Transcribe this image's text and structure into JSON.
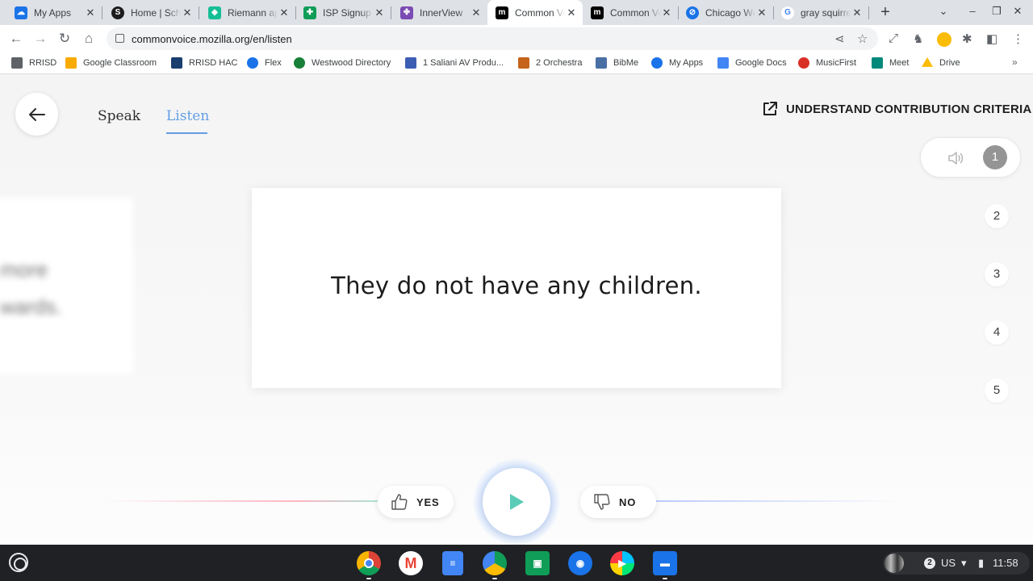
{
  "browser": {
    "tabs": [
      {
        "title": "My Apps",
        "icon": "cloud-icon",
        "color": "#1a73e8"
      },
      {
        "title": "Home | Schoology",
        "icon": "schoology-icon",
        "color": "#1c1c1c"
      },
      {
        "title": "Riemann approximation",
        "icon": "khan-icon",
        "color": "#14bf96"
      },
      {
        "title": "ISP Signup",
        "icon": "sheets-icon",
        "color": "#0f9d58"
      },
      {
        "title": "InnerView",
        "icon": "innerview-icon",
        "color": "#7b4bb4"
      },
      {
        "title": "Common Voice",
        "icon": "mozilla-icon",
        "color": "#000000"
      },
      {
        "title": "Common Voice",
        "icon": "mozilla-icon",
        "color": "#000000"
      },
      {
        "title": "Chicago Weather",
        "icon": "weather-icon",
        "color": "#1a73e8"
      },
      {
        "title": "gray squirrel",
        "icon": "google-icon",
        "color": "#4285f4"
      }
    ],
    "url": "commonvoice.mozilla.org/en/listen",
    "bookmarks": [
      {
        "label": "RRISD",
        "color": "#5f6368"
      },
      {
        "label": "Google Classroom",
        "color": "#f9ab00"
      },
      {
        "label": "RRISD HAC",
        "color": "#1a3e6e"
      },
      {
        "label": "Flex",
        "color": "#1a73e8"
      },
      {
        "label": "Westwood Directory",
        "color": "#188038"
      },
      {
        "label": "1 Saliani AV Produ...",
        "color": "#3c5fb4"
      },
      {
        "label": "2 Orchestra",
        "color": "#c5641a"
      },
      {
        "label": "BibMe",
        "color": "#4a6fa5"
      },
      {
        "label": "My Apps",
        "color": "#1a73e8"
      },
      {
        "label": "Google Docs",
        "color": "#4285f4"
      },
      {
        "label": "MusicFirst",
        "color": "#d93025"
      },
      {
        "label": "Meet",
        "color": "#00897b"
      },
      {
        "label": "Drive",
        "color": "#fbbc04"
      }
    ]
  },
  "page": {
    "tabs": {
      "speak": "Speak",
      "listen": "Listen"
    },
    "criteria_link": "UNDERSTAND CONTRIBUTION CRITERIA",
    "clips": [
      "1",
      "2",
      "3",
      "4",
      "5"
    ],
    "sentence": "They do not have any children.",
    "previous_card_fragments": [
      "more",
      "wards."
    ],
    "yes_label": "YES",
    "no_label": "NO",
    "accent_color": "#629ee5",
    "play_color": "#59cbb7"
  },
  "shelf": {
    "apps": [
      "chrome-icon",
      "gmail-icon",
      "docs-icon",
      "drive-icon",
      "classroom-icon",
      "camera-icon",
      "play-store-icon",
      "files-icon"
    ],
    "notification_count": "2",
    "ime": "US",
    "time": "11:58"
  }
}
